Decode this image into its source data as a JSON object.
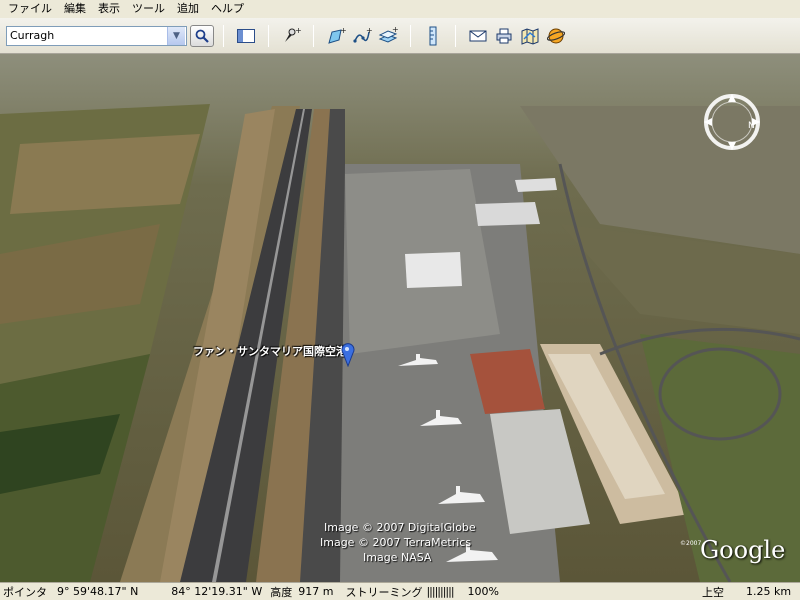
{
  "menu": {
    "items": [
      "ファイル",
      "編集",
      "表示",
      "ツール",
      "追加",
      "ヘルプ"
    ]
  },
  "toolbar": {
    "search_value": "Curragh",
    "icons": [
      "sidebar-toggle-icon",
      "placemark-add-icon",
      "polygon-add-icon",
      "path-add-icon",
      "overlay-add-icon",
      "ruler-icon",
      "email-icon",
      "print-icon",
      "map-icon",
      "sky-icon"
    ]
  },
  "map": {
    "placemark_label": "ファン・サンタマリア国際空港",
    "credits": [
      "Image © 2007 DigitalGlobe",
      "Image © 2007 TerraMetrics",
      "Image NASA"
    ],
    "logo_text": "Google",
    "logo_year": "©2007"
  },
  "status": {
    "pointer_label": "ポインタ",
    "latitude": "9° 59'48.17\" N",
    "longitude": "84° 12'19.31\" W",
    "altitude_label": "高度",
    "altitude": "917 m",
    "streaming_label": "ストリーミング",
    "streaming_bars": "||||||||||",
    "streaming_percent": "100%",
    "eye_label": "上空",
    "eye_altitude": "1.25 km"
  }
}
